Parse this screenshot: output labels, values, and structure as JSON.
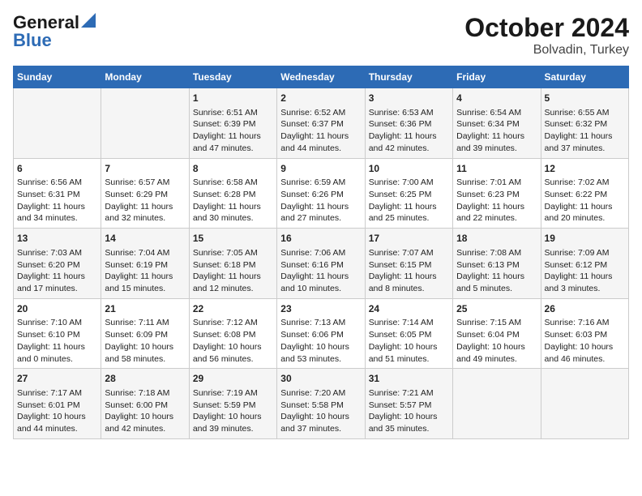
{
  "header": {
    "logo_general": "General",
    "logo_blue": "Blue",
    "month": "October 2024",
    "location": "Bolvadin, Turkey"
  },
  "days_of_week": [
    "Sunday",
    "Monday",
    "Tuesday",
    "Wednesday",
    "Thursday",
    "Friday",
    "Saturday"
  ],
  "weeks": [
    [
      {
        "day": "",
        "info": ""
      },
      {
        "day": "",
        "info": ""
      },
      {
        "day": "1",
        "info": "Sunrise: 6:51 AM\nSunset: 6:39 PM\nDaylight: 11 hours and 47 minutes."
      },
      {
        "day": "2",
        "info": "Sunrise: 6:52 AM\nSunset: 6:37 PM\nDaylight: 11 hours and 44 minutes."
      },
      {
        "day": "3",
        "info": "Sunrise: 6:53 AM\nSunset: 6:36 PM\nDaylight: 11 hours and 42 minutes."
      },
      {
        "day": "4",
        "info": "Sunrise: 6:54 AM\nSunset: 6:34 PM\nDaylight: 11 hours and 39 minutes."
      },
      {
        "day": "5",
        "info": "Sunrise: 6:55 AM\nSunset: 6:32 PM\nDaylight: 11 hours and 37 minutes."
      }
    ],
    [
      {
        "day": "6",
        "info": "Sunrise: 6:56 AM\nSunset: 6:31 PM\nDaylight: 11 hours and 34 minutes."
      },
      {
        "day": "7",
        "info": "Sunrise: 6:57 AM\nSunset: 6:29 PM\nDaylight: 11 hours and 32 minutes."
      },
      {
        "day": "8",
        "info": "Sunrise: 6:58 AM\nSunset: 6:28 PM\nDaylight: 11 hours and 30 minutes."
      },
      {
        "day": "9",
        "info": "Sunrise: 6:59 AM\nSunset: 6:26 PM\nDaylight: 11 hours and 27 minutes."
      },
      {
        "day": "10",
        "info": "Sunrise: 7:00 AM\nSunset: 6:25 PM\nDaylight: 11 hours and 25 minutes."
      },
      {
        "day": "11",
        "info": "Sunrise: 7:01 AM\nSunset: 6:23 PM\nDaylight: 11 hours and 22 minutes."
      },
      {
        "day": "12",
        "info": "Sunrise: 7:02 AM\nSunset: 6:22 PM\nDaylight: 11 hours and 20 minutes."
      }
    ],
    [
      {
        "day": "13",
        "info": "Sunrise: 7:03 AM\nSunset: 6:20 PM\nDaylight: 11 hours and 17 minutes."
      },
      {
        "day": "14",
        "info": "Sunrise: 7:04 AM\nSunset: 6:19 PM\nDaylight: 11 hours and 15 minutes."
      },
      {
        "day": "15",
        "info": "Sunrise: 7:05 AM\nSunset: 6:18 PM\nDaylight: 11 hours and 12 minutes."
      },
      {
        "day": "16",
        "info": "Sunrise: 7:06 AM\nSunset: 6:16 PM\nDaylight: 11 hours and 10 minutes."
      },
      {
        "day": "17",
        "info": "Sunrise: 7:07 AM\nSunset: 6:15 PM\nDaylight: 11 hours and 8 minutes."
      },
      {
        "day": "18",
        "info": "Sunrise: 7:08 AM\nSunset: 6:13 PM\nDaylight: 11 hours and 5 minutes."
      },
      {
        "day": "19",
        "info": "Sunrise: 7:09 AM\nSunset: 6:12 PM\nDaylight: 11 hours and 3 minutes."
      }
    ],
    [
      {
        "day": "20",
        "info": "Sunrise: 7:10 AM\nSunset: 6:10 PM\nDaylight: 11 hours and 0 minutes."
      },
      {
        "day": "21",
        "info": "Sunrise: 7:11 AM\nSunset: 6:09 PM\nDaylight: 10 hours and 58 minutes."
      },
      {
        "day": "22",
        "info": "Sunrise: 7:12 AM\nSunset: 6:08 PM\nDaylight: 10 hours and 56 minutes."
      },
      {
        "day": "23",
        "info": "Sunrise: 7:13 AM\nSunset: 6:06 PM\nDaylight: 10 hours and 53 minutes."
      },
      {
        "day": "24",
        "info": "Sunrise: 7:14 AM\nSunset: 6:05 PM\nDaylight: 10 hours and 51 minutes."
      },
      {
        "day": "25",
        "info": "Sunrise: 7:15 AM\nSunset: 6:04 PM\nDaylight: 10 hours and 49 minutes."
      },
      {
        "day": "26",
        "info": "Sunrise: 7:16 AM\nSunset: 6:03 PM\nDaylight: 10 hours and 46 minutes."
      }
    ],
    [
      {
        "day": "27",
        "info": "Sunrise: 7:17 AM\nSunset: 6:01 PM\nDaylight: 10 hours and 44 minutes."
      },
      {
        "day": "28",
        "info": "Sunrise: 7:18 AM\nSunset: 6:00 PM\nDaylight: 10 hours and 42 minutes."
      },
      {
        "day": "29",
        "info": "Sunrise: 7:19 AM\nSunset: 5:59 PM\nDaylight: 10 hours and 39 minutes."
      },
      {
        "day": "30",
        "info": "Sunrise: 7:20 AM\nSunset: 5:58 PM\nDaylight: 10 hours and 37 minutes."
      },
      {
        "day": "31",
        "info": "Sunrise: 7:21 AM\nSunset: 5:57 PM\nDaylight: 10 hours and 35 minutes."
      },
      {
        "day": "",
        "info": ""
      },
      {
        "day": "",
        "info": ""
      }
    ]
  ]
}
